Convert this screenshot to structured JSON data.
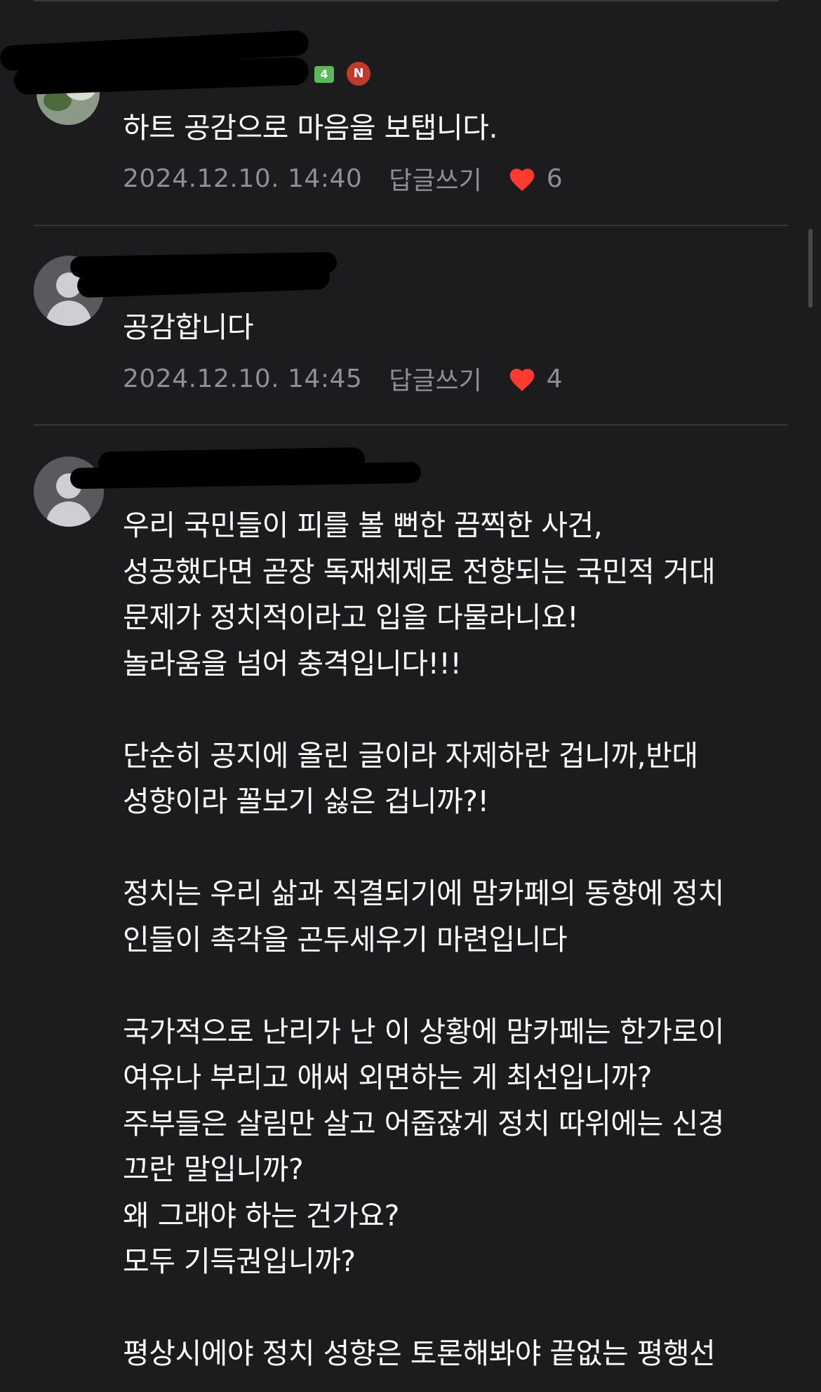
{
  "comments": [
    {
      "author_badges": {
        "grade": "4",
        "new": "N"
      },
      "text_lines": [
        "하트 공감으로 마음을 보탭니다."
      ],
      "date": "2024.12.10. 14:40",
      "reply_label": "답글쓰기",
      "like_count": "6"
    },
    {
      "text_lines": [
        "공감합니다"
      ],
      "date": "2024.12.10. 14:45",
      "reply_label": "답글쓰기",
      "like_count": "4"
    },
    {
      "text_lines": [
        "우리 국민들이 피를 볼 뻔한 끔찍한 사건,",
        "성공했다면 곧장 독재체제로 전향되는 국민적 거대",
        "문제가 정치적이라고 입을 다물라니요!",
        "놀라움을 넘어 충격입니다!!!",
        "",
        "단순히 공지에 올린 글이라 자제하란 겁니까,반대",
        "성향이라 꼴보기 싫은 겁니까?!",
        "",
        "정치는 우리 삶과 직결되기에 맘카페의 동향에 정치",
        "인들이 촉각을 곤두세우기 마련입니다",
        "",
        "국가적으로 난리가 난 이 상황에 맘카페는 한가로이",
        "여유나 부리고 애써 외면하는 게 최선입니까?",
        "주부들은 살림만 살고 어줍잖게 정치 따위에는 신경",
        "끄란 말입니까?",
        "왜 그래야 하는 건가요?",
        "모두 기득권입니까?",
        "",
        "평상시에야 정치 성향은 토론해봐야 끝없는 평행선"
      ]
    }
  ],
  "colors": {
    "background": "#1c1c1e",
    "text": "#ffffff",
    "meta": "#8e8e93",
    "heart": "#ff3b30",
    "divider": "#38383a"
  }
}
